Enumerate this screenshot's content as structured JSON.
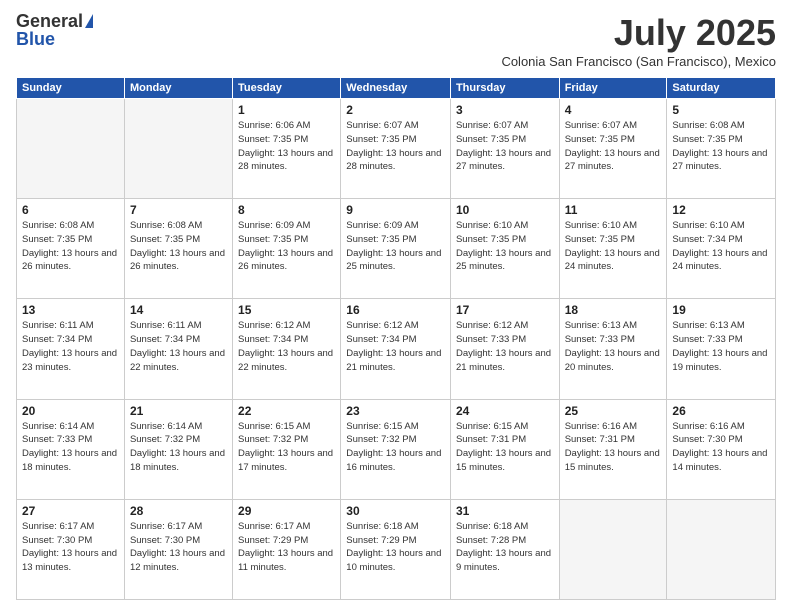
{
  "logo": {
    "general": "General",
    "blue": "Blue"
  },
  "title": "July 2025",
  "subtitle": "Colonia San Francisco (San Francisco), Mexico",
  "days_of_week": [
    "Sunday",
    "Monday",
    "Tuesday",
    "Wednesday",
    "Thursday",
    "Friday",
    "Saturday"
  ],
  "weeks": [
    [
      {
        "day": "",
        "info": ""
      },
      {
        "day": "",
        "info": ""
      },
      {
        "day": "1",
        "info": "Sunrise: 6:06 AM\nSunset: 7:35 PM\nDaylight: 13 hours and 28 minutes."
      },
      {
        "day": "2",
        "info": "Sunrise: 6:07 AM\nSunset: 7:35 PM\nDaylight: 13 hours and 28 minutes."
      },
      {
        "day": "3",
        "info": "Sunrise: 6:07 AM\nSunset: 7:35 PM\nDaylight: 13 hours and 27 minutes."
      },
      {
        "day": "4",
        "info": "Sunrise: 6:07 AM\nSunset: 7:35 PM\nDaylight: 13 hours and 27 minutes."
      },
      {
        "day": "5",
        "info": "Sunrise: 6:08 AM\nSunset: 7:35 PM\nDaylight: 13 hours and 27 minutes."
      }
    ],
    [
      {
        "day": "6",
        "info": "Sunrise: 6:08 AM\nSunset: 7:35 PM\nDaylight: 13 hours and 26 minutes."
      },
      {
        "day": "7",
        "info": "Sunrise: 6:08 AM\nSunset: 7:35 PM\nDaylight: 13 hours and 26 minutes."
      },
      {
        "day": "8",
        "info": "Sunrise: 6:09 AM\nSunset: 7:35 PM\nDaylight: 13 hours and 26 minutes."
      },
      {
        "day": "9",
        "info": "Sunrise: 6:09 AM\nSunset: 7:35 PM\nDaylight: 13 hours and 25 minutes."
      },
      {
        "day": "10",
        "info": "Sunrise: 6:10 AM\nSunset: 7:35 PM\nDaylight: 13 hours and 25 minutes."
      },
      {
        "day": "11",
        "info": "Sunrise: 6:10 AM\nSunset: 7:35 PM\nDaylight: 13 hours and 24 minutes."
      },
      {
        "day": "12",
        "info": "Sunrise: 6:10 AM\nSunset: 7:34 PM\nDaylight: 13 hours and 24 minutes."
      }
    ],
    [
      {
        "day": "13",
        "info": "Sunrise: 6:11 AM\nSunset: 7:34 PM\nDaylight: 13 hours and 23 minutes."
      },
      {
        "day": "14",
        "info": "Sunrise: 6:11 AM\nSunset: 7:34 PM\nDaylight: 13 hours and 22 minutes."
      },
      {
        "day": "15",
        "info": "Sunrise: 6:12 AM\nSunset: 7:34 PM\nDaylight: 13 hours and 22 minutes."
      },
      {
        "day": "16",
        "info": "Sunrise: 6:12 AM\nSunset: 7:34 PM\nDaylight: 13 hours and 21 minutes."
      },
      {
        "day": "17",
        "info": "Sunrise: 6:12 AM\nSunset: 7:33 PM\nDaylight: 13 hours and 21 minutes."
      },
      {
        "day": "18",
        "info": "Sunrise: 6:13 AM\nSunset: 7:33 PM\nDaylight: 13 hours and 20 minutes."
      },
      {
        "day": "19",
        "info": "Sunrise: 6:13 AM\nSunset: 7:33 PM\nDaylight: 13 hours and 19 minutes."
      }
    ],
    [
      {
        "day": "20",
        "info": "Sunrise: 6:14 AM\nSunset: 7:33 PM\nDaylight: 13 hours and 18 minutes."
      },
      {
        "day": "21",
        "info": "Sunrise: 6:14 AM\nSunset: 7:32 PM\nDaylight: 13 hours and 18 minutes."
      },
      {
        "day": "22",
        "info": "Sunrise: 6:15 AM\nSunset: 7:32 PM\nDaylight: 13 hours and 17 minutes."
      },
      {
        "day": "23",
        "info": "Sunrise: 6:15 AM\nSunset: 7:32 PM\nDaylight: 13 hours and 16 minutes."
      },
      {
        "day": "24",
        "info": "Sunrise: 6:15 AM\nSunset: 7:31 PM\nDaylight: 13 hours and 15 minutes."
      },
      {
        "day": "25",
        "info": "Sunrise: 6:16 AM\nSunset: 7:31 PM\nDaylight: 13 hours and 15 minutes."
      },
      {
        "day": "26",
        "info": "Sunrise: 6:16 AM\nSunset: 7:30 PM\nDaylight: 13 hours and 14 minutes."
      }
    ],
    [
      {
        "day": "27",
        "info": "Sunrise: 6:17 AM\nSunset: 7:30 PM\nDaylight: 13 hours and 13 minutes."
      },
      {
        "day": "28",
        "info": "Sunrise: 6:17 AM\nSunset: 7:30 PM\nDaylight: 13 hours and 12 minutes."
      },
      {
        "day": "29",
        "info": "Sunrise: 6:17 AM\nSunset: 7:29 PM\nDaylight: 13 hours and 11 minutes."
      },
      {
        "day": "30",
        "info": "Sunrise: 6:18 AM\nSunset: 7:29 PM\nDaylight: 13 hours and 10 minutes."
      },
      {
        "day": "31",
        "info": "Sunrise: 6:18 AM\nSunset: 7:28 PM\nDaylight: 13 hours and 9 minutes."
      },
      {
        "day": "",
        "info": ""
      },
      {
        "day": "",
        "info": ""
      }
    ]
  ]
}
